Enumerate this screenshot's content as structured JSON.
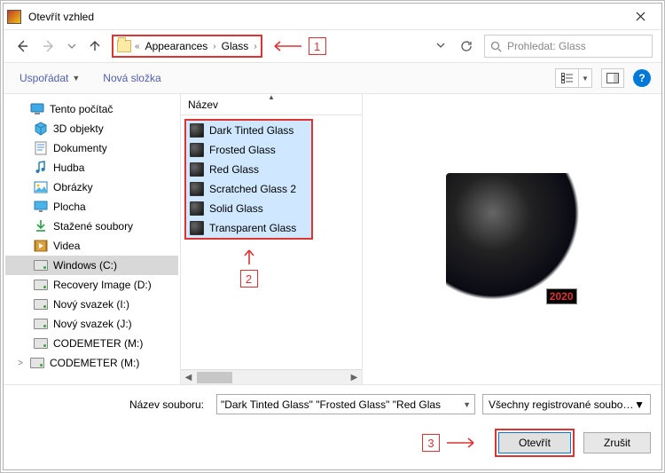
{
  "window": {
    "title": "Otevřít vzhled"
  },
  "breadcrumb": {
    "prefix_sep": "«",
    "items": [
      "Appearances",
      "Glass"
    ]
  },
  "search": {
    "placeholder": "Prohledat: Glass"
  },
  "toolbar": {
    "organize": "Uspořádat",
    "new_folder": "Nová složka",
    "help_label": "?"
  },
  "nav_tree": [
    {
      "label": "Tento počítač",
      "icon": "pc",
      "indent": 0,
      "expander": ""
    },
    {
      "label": "3D objekty",
      "icon": "3d",
      "indent": 1
    },
    {
      "label": "Dokumenty",
      "icon": "docs",
      "indent": 1
    },
    {
      "label": "Hudba",
      "icon": "music",
      "indent": 1
    },
    {
      "label": "Obrázky",
      "icon": "pics",
      "indent": 1
    },
    {
      "label": "Plocha",
      "icon": "desktop",
      "indent": 1
    },
    {
      "label": "Stažené soubory",
      "icon": "downloads",
      "indent": 1
    },
    {
      "label": "Videa",
      "icon": "videos",
      "indent": 1
    },
    {
      "label": "Windows (C:)",
      "icon": "drive",
      "indent": 1,
      "selected": true
    },
    {
      "label": "Recovery Image (D:)",
      "icon": "drive",
      "indent": 1
    },
    {
      "label": "Nový svazek (I:)",
      "icon": "drive",
      "indent": 1
    },
    {
      "label": "Nový svazek (J:)",
      "icon": "drive",
      "indent": 1
    },
    {
      "label": "CODEMETER (M:)",
      "icon": "drive",
      "indent": 1
    },
    {
      "label": "CODEMETER (M:)",
      "icon": "drive",
      "indent": 0,
      "expander": ">"
    }
  ],
  "list": {
    "header": "Název",
    "items": [
      "Dark Tinted Glass",
      "Frosted Glass",
      "Red Glass",
      "Scratched Glass 2",
      "Solid Glass",
      "Transparent Glass"
    ]
  },
  "preview": {
    "badge_year": "2020"
  },
  "filename_row": {
    "label": "Název souboru:",
    "value": "\"Dark Tinted Glass\" \"Frosted Glass\" \"Red Glas",
    "filter": "Všechny registrované soubory v"
  },
  "buttons": {
    "open": "Otevřít",
    "cancel": "Zrušit"
  },
  "callouts": {
    "c1": "1",
    "c2": "2",
    "c3": "3"
  }
}
